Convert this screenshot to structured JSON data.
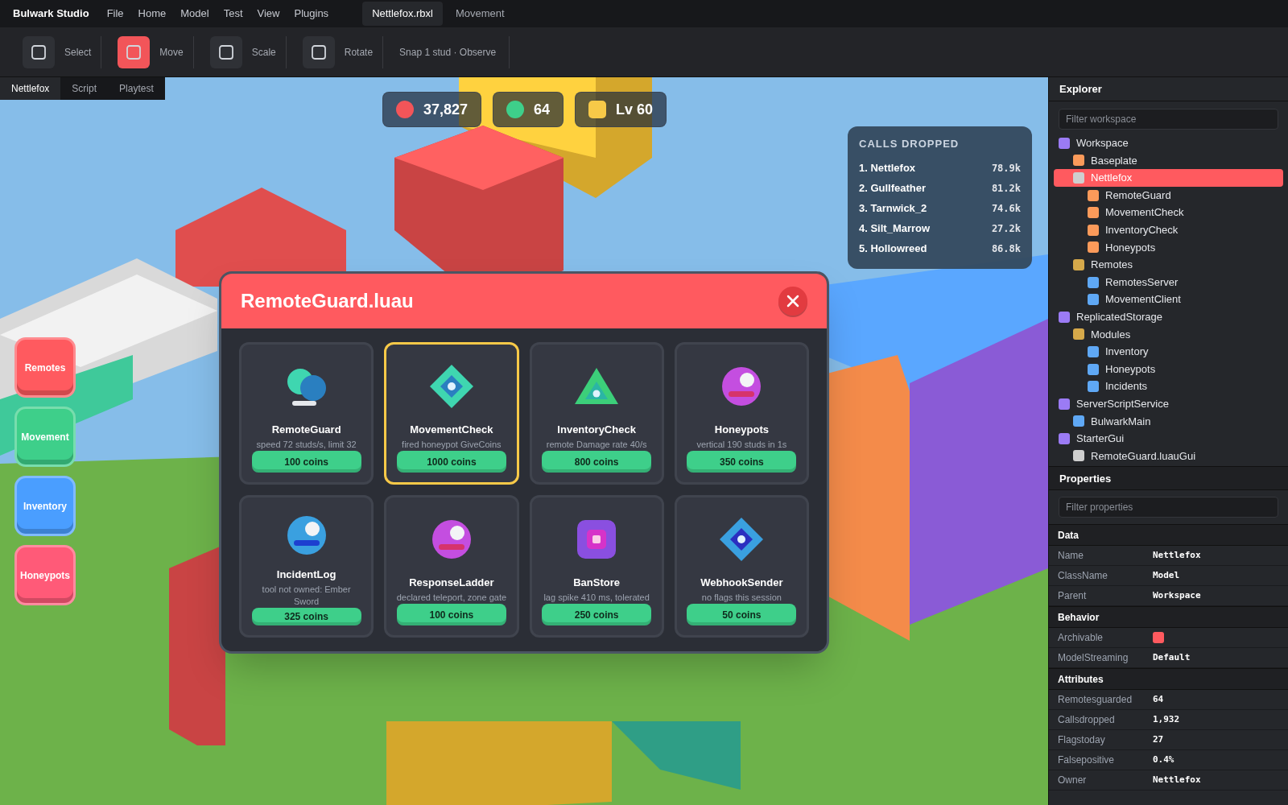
{
  "app_title": "Bulwark Studio",
  "menu": [
    "File",
    "Home",
    "Model",
    "Test",
    "View",
    "Plugins"
  ],
  "doc_tabs": [
    {
      "label": "Nettlefox.rbxl",
      "selected": true
    },
    {
      "label": "Movement",
      "selected": false
    }
  ],
  "toolbar": {
    "tools": [
      {
        "label": "Select",
        "selected": false
      },
      {
        "label": "Move",
        "selected": true
      },
      {
        "label": "Scale",
        "selected": false
      },
      {
        "label": "Rotate",
        "selected": false
      }
    ],
    "snap": "Snap 1 stud · Observe"
  },
  "viewport_tabs": [
    {
      "label": "Nettlefox",
      "selected": true
    },
    {
      "label": "Script",
      "selected": false
    },
    {
      "label": "Playtest",
      "selected": false
    }
  ],
  "hud": [
    {
      "kind": "dot",
      "color": "#f25559",
      "value": "37,827"
    },
    {
      "kind": "dot",
      "color": "#3ecf8a",
      "value": "64"
    },
    {
      "kind": "square",
      "color": "#f7c948",
      "value": "Lv 60"
    }
  ],
  "leaderboard": {
    "title": "CALLS DROPPED",
    "rows": [
      {
        "name": "1. Nettlefox",
        "value": "78.9k"
      },
      {
        "name": "2. Gullfeather",
        "value": "81.2k"
      },
      {
        "name": "3. Tarnwick_2",
        "value": "74.6k"
      },
      {
        "name": "4. Silt_Marrow",
        "value": "27.2k"
      },
      {
        "name": "5. Hollowreed",
        "value": "86.8k"
      }
    ]
  },
  "side_buttons": [
    {
      "label": "Remotes",
      "color": "#ff5a5f"
    },
    {
      "label": "Movement",
      "color": "#3ecf8a"
    },
    {
      "label": "Inventory",
      "color": "#4a9eff"
    },
    {
      "label": "Honeypots",
      "color": "#ff5a78"
    }
  ],
  "dialog": {
    "title": "RemoteGuard.luau",
    "cards": [
      {
        "kind": "bubbles",
        "color": "#3fd6b0",
        "title": "RemoteGuard",
        "subtitle": "speed 72 studs/s, limit 32",
        "price": "100 coins",
        "selected": false
      },
      {
        "kind": "diamond",
        "color": "#3fd6b0",
        "title": "MovementCheck",
        "subtitle": "fired honeypot GiveCoins",
        "price": "1000 coins",
        "selected": true
      },
      {
        "kind": "triangle",
        "color": "#3ccf7a",
        "title": "InventoryCheck",
        "subtitle": "remote Damage rate 40/s",
        "price": "800 coins",
        "selected": false
      },
      {
        "kind": "orb",
        "color": "#c44ee0",
        "title": "Honeypots",
        "subtitle": "vertical 190 studs in 1s",
        "price": "350 coins",
        "selected": false
      },
      {
        "kind": "orb",
        "color": "#3aa0e0",
        "title": "IncidentLog",
        "subtitle": "tool not owned: Ember Sword",
        "price": "325 coins",
        "selected": false
      },
      {
        "kind": "orb",
        "color": "#c44ee0",
        "title": "ResponseLadder",
        "subtitle": "declared teleport, zone gate",
        "price": "100 coins",
        "selected": false
      },
      {
        "kind": "square",
        "color": "#8a4fe0",
        "title": "BanStore",
        "subtitle": "lag spike 410 ms, tolerated",
        "price": "250 coins",
        "selected": false
      },
      {
        "kind": "diamond",
        "color": "#3aa0e0",
        "title": "WebhookSender",
        "subtitle": "no flags this session",
        "price": "50 coins",
        "selected": false
      }
    ]
  },
  "explorer": {
    "title": "Explorer",
    "placeholder": "Filter workspace",
    "items": [
      {
        "label": "Workspace",
        "color": "#9b7bf5",
        "selected": false,
        "children": [
          {
            "label": "Baseplate",
            "color": "#fb9a5a",
            "selected": false
          },
          {
            "label": "Nettlefox",
            "color": "#cfcfcf",
            "selected": true,
            "children": [
              {
                "label": "RemoteGuard",
                "color": "#fb9a5a",
                "selected": false
              },
              {
                "label": "MovementCheck",
                "color": "#fb9a5a",
                "selected": false
              },
              {
                "label": "InventoryCheck",
                "color": "#fb9a5a",
                "selected": false
              },
              {
                "label": "Honeypots",
                "color": "#fb9a5a",
                "selected": false
              }
            ]
          },
          {
            "label": "Remotes",
            "color": "#d6a94a",
            "selected": false,
            "children": [
              {
                "label": "RemotesServer",
                "color": "#5fa8f5",
                "selected": false
              },
              {
                "label": "MovementClient",
                "color": "#5fa8f5",
                "selected": false
              }
            ]
          }
        ]
      },
      {
        "label": "ReplicatedStorage",
        "color": "#9b7bf5",
        "selected": false,
        "children": [
          {
            "label": "Modules",
            "color": "#d6a94a",
            "selected": false,
            "children": [
              {
                "label": "Inventory",
                "color": "#5fa8f5",
                "selected": false
              },
              {
                "label": "Honeypots",
                "color": "#5fa8f5",
                "selected": false
              },
              {
                "label": "Incidents",
                "color": "#5fa8f5",
                "selected": false
              }
            ]
          }
        ]
      },
      {
        "label": "ServerScriptService",
        "color": "#9b7bf5",
        "selected": false,
        "children": [
          {
            "label": "BulwarkMain",
            "color": "#5fa8f5",
            "selected": false
          }
        ]
      },
      {
        "label": "StarterGui",
        "color": "#9b7bf5",
        "selected": false,
        "children": [
          {
            "label": "RemoteGuard.luauGui",
            "color": "#cfcfcf",
            "selected": false
          }
        ]
      }
    ]
  },
  "properties": {
    "title": "Properties",
    "placeholder": "Filter properties",
    "sections": [
      {
        "title": "Data",
        "rows": [
          {
            "kind": "text",
            "name": "Name",
            "value": "Nettlefox"
          },
          {
            "kind": "text",
            "name": "ClassName",
            "value": "Model"
          },
          {
            "kind": "text",
            "name": "Parent",
            "value": "Workspace"
          }
        ]
      },
      {
        "title": "Behavior",
        "rows": [
          {
            "kind": "swatch",
            "name": "Archivable",
            "color": "#ff5a5f"
          },
          {
            "kind": "text",
            "name": "ModelStreaming",
            "value": "Default"
          }
        ]
      },
      {
        "title": "Attributes",
        "rows": [
          {
            "kind": "text",
            "name": "Remotesguarded",
            "value": "64"
          },
          {
            "kind": "text",
            "name": "Callsdropped",
            "value": "1,932"
          },
          {
            "kind": "text",
            "name": "Flagstoday",
            "value": "27"
          },
          {
            "kind": "text",
            "name": "Falsepositive",
            "value": "0.4%"
          },
          {
            "kind": "text",
            "name": "Owner",
            "value": "Nettlefox"
          }
        ]
      }
    ]
  }
}
